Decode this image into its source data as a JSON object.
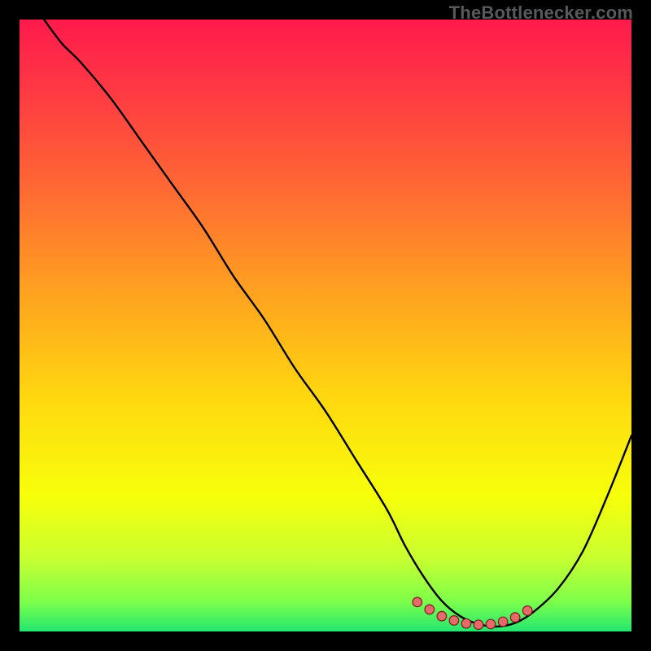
{
  "watermark": "TheBottlenecker.com",
  "colors": {
    "frame_bg": "#000000",
    "watermark": "#58595b",
    "curve": "#000000",
    "dot_fill": "#e66a6a",
    "dot_stroke": "#7a1e1e",
    "gradient_stops": [
      {
        "offset": 0.0,
        "color": "#ff1a4c"
      },
      {
        "offset": 0.12,
        "color": "#ff3a43"
      },
      {
        "offset": 0.28,
        "color": "#ff6a33"
      },
      {
        "offset": 0.45,
        "color": "#ffa31f"
      },
      {
        "offset": 0.62,
        "color": "#ffd80f"
      },
      {
        "offset": 0.78,
        "color": "#f7ff0a"
      },
      {
        "offset": 0.88,
        "color": "#c8ff30"
      },
      {
        "offset": 0.95,
        "color": "#7fff4a"
      },
      {
        "offset": 1.0,
        "color": "#23e66f"
      }
    ]
  },
  "chart_data": {
    "type": "line",
    "title": "",
    "xlabel": "",
    "ylabel": "",
    "xlim": [
      0,
      100
    ],
    "ylim": [
      0,
      100
    ],
    "series": [
      {
        "name": "bottleneck-curve",
        "x": [
          4,
          7,
          10,
          15,
          20,
          25,
          30,
          35,
          40,
          45,
          50,
          55,
          60,
          63,
          66,
          69,
          72,
          75,
          78,
          81,
          84,
          88,
          92,
          96,
          100
        ],
        "y": [
          100,
          96,
          93,
          87,
          80,
          73,
          66,
          58,
          51,
          43,
          36,
          28,
          20,
          14,
          9,
          5,
          2.5,
          1.2,
          0.8,
          1.4,
          3.2,
          7,
          13,
          22,
          32
        ]
      }
    ],
    "highlight_points": {
      "name": "optimal-range-dots",
      "x": [
        65,
        67,
        69,
        71,
        73,
        75,
        77,
        79,
        81,
        83
      ],
      "y": [
        4.8,
        3.6,
        2.5,
        1.8,
        1.3,
        1.1,
        1.2,
        1.6,
        2.3,
        3.4
      ]
    }
  }
}
